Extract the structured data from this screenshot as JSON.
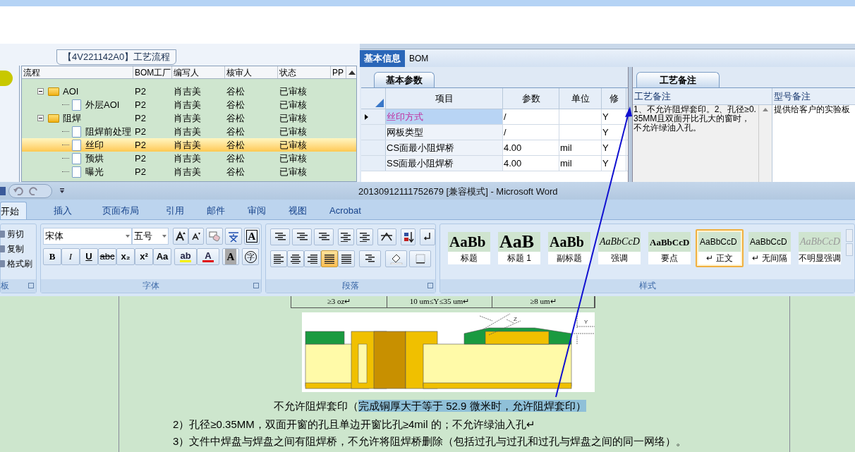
{
  "flow_panel": {
    "title": "【4V221142A0】工艺流程",
    "tree_header": "流程",
    "columns": [
      "BOM工厂",
      "编写人",
      "核审人",
      "状态",
      "PP"
    ],
    "rows": [
      {
        "label": "AOI",
        "kind": "folder",
        "expanded": true,
        "selected": false,
        "cells": [
          "P2",
          "肖吉美",
          "谷松",
          "已审核"
        ],
        "children": [
          {
            "label": "外层AOI",
            "kind": "file",
            "selected": false,
            "cells": [
              "P2",
              "肖吉美",
              "谷松",
              "已审核"
            ]
          }
        ]
      },
      {
        "label": "阻焊",
        "kind": "folder",
        "expanded": true,
        "selected": false,
        "cells": [
          "P2",
          "肖吉美",
          "谷松",
          "已审核"
        ],
        "children": [
          {
            "label": "阻焊前处理",
            "kind": "file",
            "selected": false,
            "cells": [
              "P2",
              "肖吉美",
              "谷松",
              "已审核"
            ]
          },
          {
            "label": "丝印",
            "kind": "file",
            "selected": true,
            "cells": [
              "P2",
              "肖吉美",
              "谷松",
              "已审核"
            ]
          },
          {
            "label": "预烘",
            "kind": "file",
            "selected": false,
            "cells": [
              "P2",
              "肖吉美",
              "谷松",
              "已审核"
            ]
          },
          {
            "label": "曝光",
            "kind": "file",
            "selected": false,
            "cells": [
              "P2",
              "肖吉美",
              "谷松",
              "已审核"
            ]
          }
        ]
      }
    ]
  },
  "info_panel": {
    "tabs": [
      {
        "label": "基本信息",
        "selected": true
      },
      {
        "label": "BOM",
        "selected": false
      }
    ],
    "params": {
      "tab": "基本参数",
      "columns": [
        "项目",
        "参数",
        "单位",
        "修"
      ],
      "rows": [
        {
          "cells": [
            "丝印方式",
            "/",
            "",
            "Y"
          ],
          "selected": true
        },
        {
          "cells": [
            "网板类型",
            "/",
            "",
            "Y"
          ],
          "selected": false
        },
        {
          "cells": [
            "CS面最小阻焊桥",
            "4.00",
            "mil",
            "Y"
          ],
          "selected": false
        },
        {
          "cells": [
            "SS面最小阻焊桥",
            "4.00",
            "mil",
            "Y"
          ],
          "selected": false
        }
      ]
    },
    "notes": {
      "tab": "工艺备注",
      "columns": [
        "工艺备注",
        "型号备注"
      ],
      "cells": [
        "1、不允许阻焊套印。2、孔径≥0.35MM且双面开比孔大的窗时，不允许绿油入孔。",
        "提供给客户的实验板"
      ]
    }
  },
  "word": {
    "title": "20130912111752679 [兼容模式] - Microsoft Word",
    "tabs": [
      {
        "label": "开始",
        "selected": true
      },
      {
        "label": "插入",
        "selected": false
      },
      {
        "label": "页面布局",
        "selected": false
      },
      {
        "label": "引用",
        "selected": false
      },
      {
        "label": "邮件",
        "selected": false
      },
      {
        "label": "审阅",
        "selected": false
      },
      {
        "label": "视图",
        "selected": false
      },
      {
        "label": "Acrobat",
        "selected": false
      }
    ],
    "clipboard": {
      "items": [
        "剪切",
        "复制",
        "格式刷"
      ],
      "label": "板"
    },
    "font": {
      "name": "宋体",
      "size": "五号",
      "label": "字体",
      "boxed": "A",
      "format_buttons": [
        {
          "label": "B",
          "kind": "bold"
        },
        {
          "label": "I",
          "kind": "italic"
        },
        {
          "label": "U",
          "kind": "underline"
        },
        {
          "label": "abc",
          "kind": "strike"
        },
        {
          "label": "x₂",
          "kind": "plain"
        },
        {
          "label": "x²",
          "kind": "plain"
        },
        {
          "label": "Aa",
          "kind": "plain"
        }
      ],
      "color_buttons": [
        {
          "label": "ab",
          "color": "#f5f000"
        },
        {
          "label": "A",
          "color": "#e01010"
        }
      ],
      "extra_buttons": [
        {
          "label": "A",
          "kind": "shaded"
        },
        {
          "label": "字",
          "kind": "circled"
        }
      ]
    },
    "paragraph": {
      "label": "段落",
      "align_buttons": [
        {
          "kind": "left",
          "selected": false
        },
        {
          "kind": "center",
          "selected": false
        },
        {
          "kind": "right",
          "selected": false
        },
        {
          "kind": "justify",
          "selected": true
        },
        {
          "kind": "distributed",
          "selected": false
        }
      ]
    },
    "styles": {
      "label": "样式",
      "items": [
        {
          "preview": "AaBb",
          "name": "标题",
          "kind": "title",
          "selected": false
        },
        {
          "preview": "AaB",
          "name": "标题 1",
          "kind": "heading",
          "selected": false
        },
        {
          "preview": "AaBb",
          "name": "副标题",
          "kind": "subtitle",
          "selected": false
        },
        {
          "preview": "AaBbCcD",
          "name": "强调",
          "kind": "emphasis",
          "selected": false
        },
        {
          "preview": "AaBbCcD",
          "name": "要点",
          "kind": "strong",
          "selected": false
        },
        {
          "preview": "AaBbCcD",
          "name": "↵ 正文",
          "kind": "normal",
          "selected": true
        },
        {
          "preview": "AaBbCcD",
          "name": "↵ 无间隔",
          "kind": "normal",
          "selected": false
        },
        {
          "preview": "AaBbCcD",
          "name": "不明显强调",
          "kind": "subtle",
          "selected": false
        }
      ]
    }
  },
  "document": {
    "table_cells": [
      "≥3 oz↵",
      "10 um≤Y≤35 um↵",
      "≥8 um↵"
    ],
    "figure": {
      "labels": [
        "Z",
        "Y"
      ]
    },
    "caption": "不允许阻焊套印（",
    "caption_highlight": "完成铜厚大于等于 52.9 微米时，允许阻焊套印）",
    "lines": [
      "2）孔径≥0.35MM，双面开窗的孔且单边开窗比孔≥4mil 的；不允许绿油入孔↵",
      "3）文件中焊盘与焊盘之间有阻焊桥，不允许将阻焊桥删除（包括过孔与过孔和过孔与焊盘之间的同一网络）。"
    ]
  }
}
